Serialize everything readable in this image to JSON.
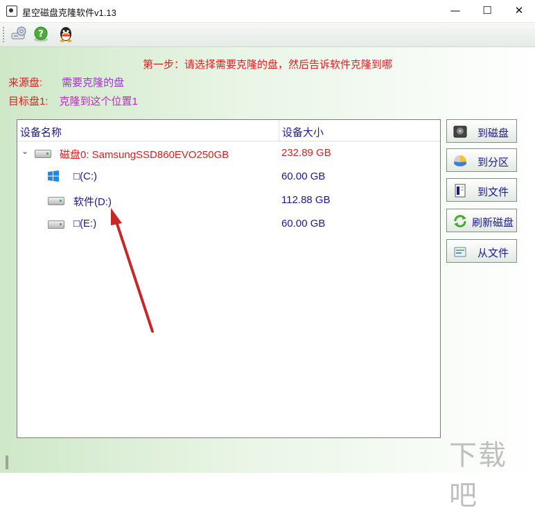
{
  "window": {
    "title": "星空磁盘克隆软件v1.13",
    "minimize_glyph": "—",
    "maximize_glyph": "☐",
    "close_glyph": "✕"
  },
  "toolbar": {
    "buttons": [
      {
        "name": "settings-disk-icon"
      },
      {
        "name": "help-icon"
      },
      {
        "name": "qq-icon"
      }
    ]
  },
  "instructions": {
    "step": "第一步：请选择需要克隆的盘，然后告诉软件克隆到哪",
    "source_label": "来源盘:",
    "source_value": "需要克隆的盘",
    "target_label": "目标盘1:",
    "target_value": "克隆到这个位置1"
  },
  "device_list": {
    "col_name": "设备名称",
    "col_size": "设备大小",
    "rows": [
      {
        "name": "磁盘0: SamsungSSD860EVO250GB",
        "size": "232.89 GB",
        "level": 0,
        "color": "#d42020",
        "icon": "disk-icon",
        "expanded": true
      },
      {
        "name": "□(C:)",
        "size": "60.00 GB",
        "level": 1,
        "color": "#1a1a8a",
        "icon": "windows-icon"
      },
      {
        "name": "软件(D:)",
        "size": "112.88 GB",
        "level": 1,
        "color": "#1a1a8a",
        "icon": "disk-icon"
      },
      {
        "name": "□(E:)",
        "size": "60.00 GB",
        "level": 1,
        "color": "#1a1a8a",
        "icon": "disk-icon"
      }
    ]
  },
  "side_buttons": {
    "to_disk": "到磁盘",
    "to_partition": "到分区",
    "to_file": "到文件",
    "refresh_disk": "刷新磁盘",
    "from_file": "从文件"
  },
  "watermark": "下载吧",
  "colors": {
    "accent_red": "#e02020",
    "purple": "#9b39c8",
    "magenta": "#cc22cc",
    "navy": "#1a1a8a"
  }
}
